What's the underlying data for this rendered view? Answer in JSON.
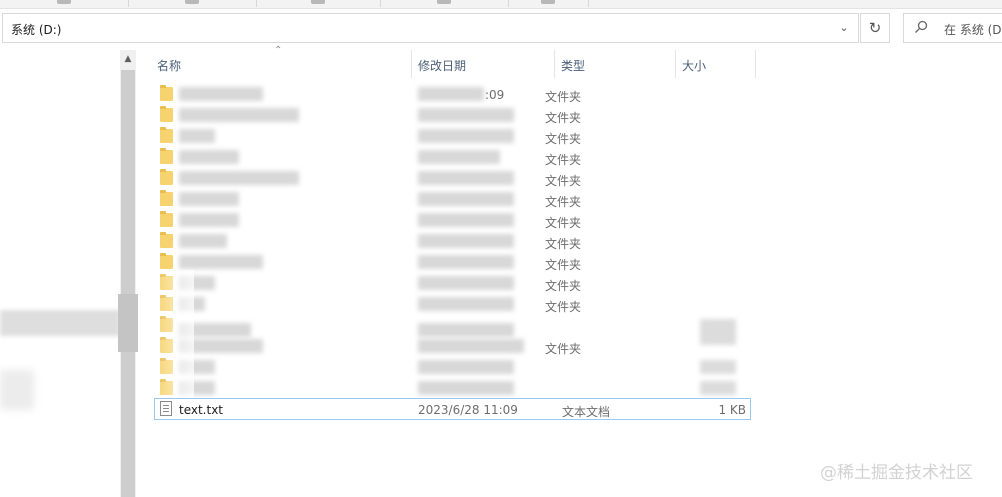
{
  "address_bar": {
    "path": "系统 (D:)"
  },
  "search": {
    "placeholder": "在 系统 (D:"
  },
  "columns": {
    "name": "名称",
    "date": "修改日期",
    "type": "类型",
    "size": "大小"
  },
  "rows": [
    {
      "date_fragment": ":09",
      "type": "文件夹"
    },
    {
      "type": "文件夹"
    },
    {
      "type": "文件夹"
    },
    {
      "type": "文件夹"
    },
    {
      "type": "文件夹"
    },
    {
      "type": "文件夹"
    },
    {
      "type": "文件夹"
    },
    {
      "type": "文件夹"
    },
    {
      "type": "文件夹"
    },
    {
      "type": "文件夹"
    },
    {
      "type": "文件夹"
    },
    {
      "type": ""
    },
    {
      "type": "文件夹"
    },
    {
      "type": ""
    },
    {
      "type": ""
    }
  ],
  "selected_file": {
    "name": "text.txt",
    "date": "2023/6/28 11:09",
    "type": "文本文档",
    "size": "1 KB"
  },
  "watermark": "@稀土掘金技术社区"
}
